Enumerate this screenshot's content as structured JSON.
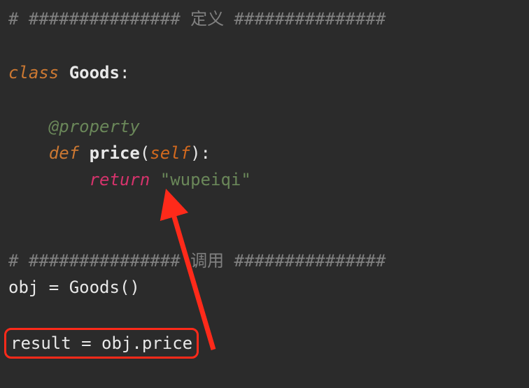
{
  "code": {
    "line1_comment_prefix": "# ############### ",
    "line1_comment_word": "定义",
    "line1_comment_suffix": " ###############",
    "line3_class_kw": "class",
    "line3_class_name": " Goods",
    "line3_colon": ":",
    "line5_decorator": "    @property",
    "line6_def_kw": "    def ",
    "line6_func_name": "price",
    "line6_open": "(",
    "line6_self": "self",
    "line6_close": "):",
    "line7_indent": "        ",
    "line7_return": "return",
    "line7_space": " ",
    "line7_string": "\"wupeiqi\"",
    "line10_comment_prefix": "# ############### ",
    "line10_comment_word": "调用",
    "line10_comment_suffix": " ###############",
    "line11": "obj = Goods()",
    "line13": "result = obj.price"
  }
}
